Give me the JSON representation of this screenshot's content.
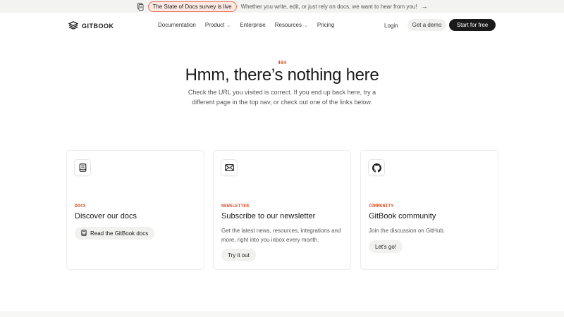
{
  "announcement": {
    "pill": "The State of Docs survey is live",
    "text": "Whether you write, edit, or just rely on docs, we want to hear from you!",
    "arrow": "→"
  },
  "header": {
    "logo": "GITBOOK",
    "nav": [
      {
        "label": "Documentation",
        "dropdown": false
      },
      {
        "label": "Product",
        "dropdown": true
      },
      {
        "label": "Enterprise",
        "dropdown": false
      },
      {
        "label": "Resources",
        "dropdown": true
      },
      {
        "label": "Pricing",
        "dropdown": false
      }
    ],
    "chevron": "⌄",
    "login": "Login",
    "demo": "Get a demo",
    "start": "Start for free"
  },
  "hero": {
    "code": "404",
    "title": "Hmm, there’s nothing here",
    "subtitle": "Check the URL you visited is correct. If you end up back here, try a different page in the top nav, or check out one of the links below."
  },
  "cards": [
    {
      "tag": "DOCS",
      "title": "Discover our docs",
      "desc": "",
      "button": "Read the GitBook docs",
      "icon": "book-icon"
    },
    {
      "tag": "NEWSLETTER",
      "title": "Subscribe to our newsletter",
      "desc": "Get the latest news, resources, integrations and more, right into you inbox every month.",
      "button": "Try it out",
      "icon": "mail-icon"
    },
    {
      "tag": "COMMUNITY",
      "title": "GitBook community",
      "desc": "Join the discussion on GitHub.",
      "button": "Let's go!",
      "icon": "github-icon"
    }
  ],
  "colors": {
    "accent": "#e0552e",
    "dark_button": "#1a1a1a",
    "pill_border": "#e8735a"
  }
}
